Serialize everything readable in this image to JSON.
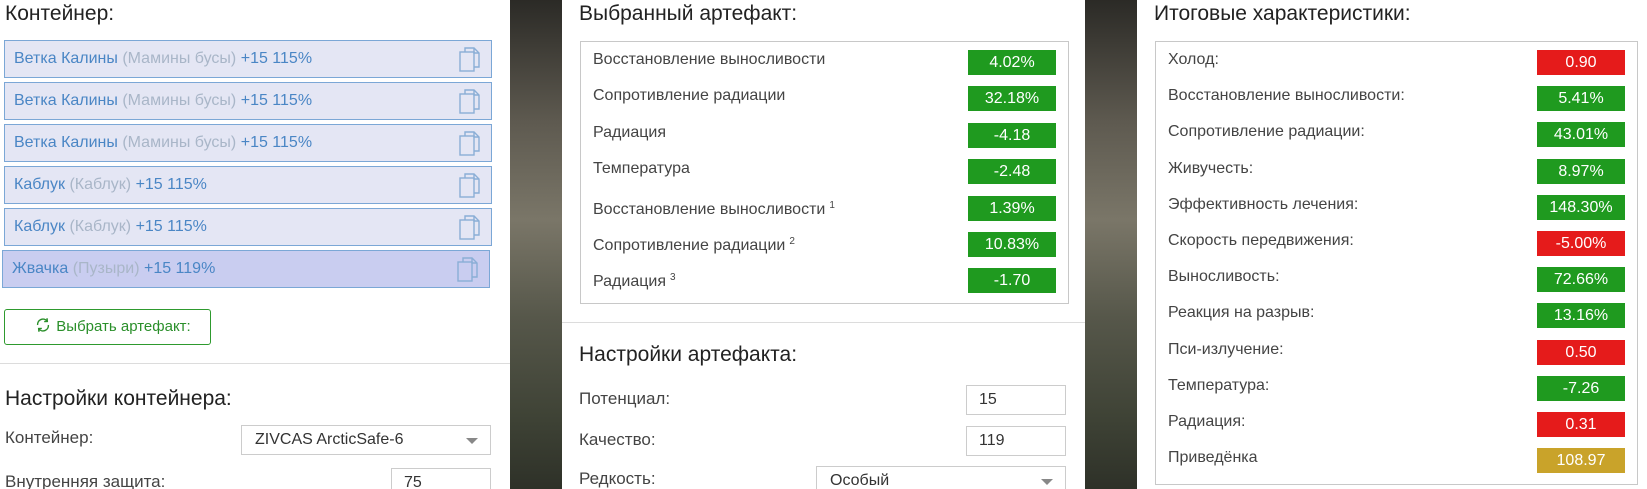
{
  "colors": {
    "green": "#1f9a1f",
    "red": "#e51b1b",
    "gold": "#c9a32a",
    "accent": "#4a86c5"
  },
  "container": {
    "title": "Контейнер:",
    "items": [
      {
        "name": "Ветка Калины",
        "sub": "(Мамины бусы)",
        "bonus": "+15 115%",
        "icon": "copy-icon"
      },
      {
        "name": "Ветка Калины",
        "sub": "(Мамины бусы)",
        "bonus": "+15 115%",
        "icon": "copy-icon"
      },
      {
        "name": "Ветка Калины",
        "sub": "(Мамины бусы)",
        "bonus": "+15 115%",
        "icon": "copy-icon"
      },
      {
        "name": "Каблук",
        "sub": "(Каблук)",
        "bonus": "+15 115%",
        "icon": "copy-icon"
      },
      {
        "name": "Каблук",
        "sub": "(Каблук)",
        "bonus": "+15 115%",
        "icon": "copy-icon"
      },
      {
        "name": "Жвачка",
        "sub": "(Пузыри)",
        "bonus": "+15 119%",
        "icon": "copy-icon"
      }
    ],
    "choose_button": "Выбрать артефакт:",
    "settings_title": "Настройки контейнера:",
    "container_label": "Контейнер:",
    "container_value": "ZIVCAS ArcticSafe-6",
    "protection_label": "Внутренняя защита:",
    "protection_value": "75"
  },
  "artifact": {
    "title": "Выбранный артефакт:",
    "stats": [
      {
        "label": "Восстановление выносливости",
        "sup": "",
        "value": "4.02%",
        "color": "green"
      },
      {
        "label": "Сопротивление радиации",
        "sup": "",
        "value": "32.18%",
        "color": "green"
      },
      {
        "label": "Радиация",
        "sup": "",
        "value": "-4.18",
        "color": "green"
      },
      {
        "label": "Температура",
        "sup": "",
        "value": "-2.48",
        "color": "green"
      },
      {
        "label": "Восстановление выносливости",
        "sup": "1",
        "value": "1.39%",
        "color": "green"
      },
      {
        "label": "Сопротивление радиации",
        "sup": "2",
        "value": "10.83%",
        "color": "green"
      },
      {
        "label": "Радиация",
        "sup": "3",
        "value": "-1.70",
        "color": "green"
      }
    ],
    "settings_title": "Настройки артефакта:",
    "potential_label": "Потенциал:",
    "potential_value": "15",
    "quality_label": "Качество:",
    "quality_value": "119",
    "rarity_label": "Редкость:",
    "rarity_value": "Особый"
  },
  "totals": {
    "title": "Итоговые характеристики:",
    "stats": [
      {
        "label": "Холод:",
        "value": "0.90",
        "color": "red"
      },
      {
        "label": "Восстановление выносливости:",
        "value": "5.41%",
        "color": "green"
      },
      {
        "label": "Сопротивление радиации:",
        "value": "43.01%",
        "color": "green"
      },
      {
        "label": "Живучесть:",
        "value": "8.97%",
        "color": "green"
      },
      {
        "label": "Эффективность лечения:",
        "value": "148.30%",
        "color": "green"
      },
      {
        "label": "Скорость передвижения:",
        "value": "-5.00%",
        "color": "red"
      },
      {
        "label": "Выносливость:",
        "value": "72.66%",
        "color": "green"
      },
      {
        "label": "Реакция на разрыв:",
        "value": "13.16%",
        "color": "green"
      },
      {
        "label": "Пси-излучение:",
        "value": "0.50",
        "color": "red"
      },
      {
        "label": "Температура:",
        "value": "-7.26",
        "color": "green"
      },
      {
        "label": "Радиация:",
        "value": "0.31",
        "color": "red"
      },
      {
        "label": "Приведёнка",
        "value": "108.97",
        "color": "gold"
      }
    ]
  }
}
